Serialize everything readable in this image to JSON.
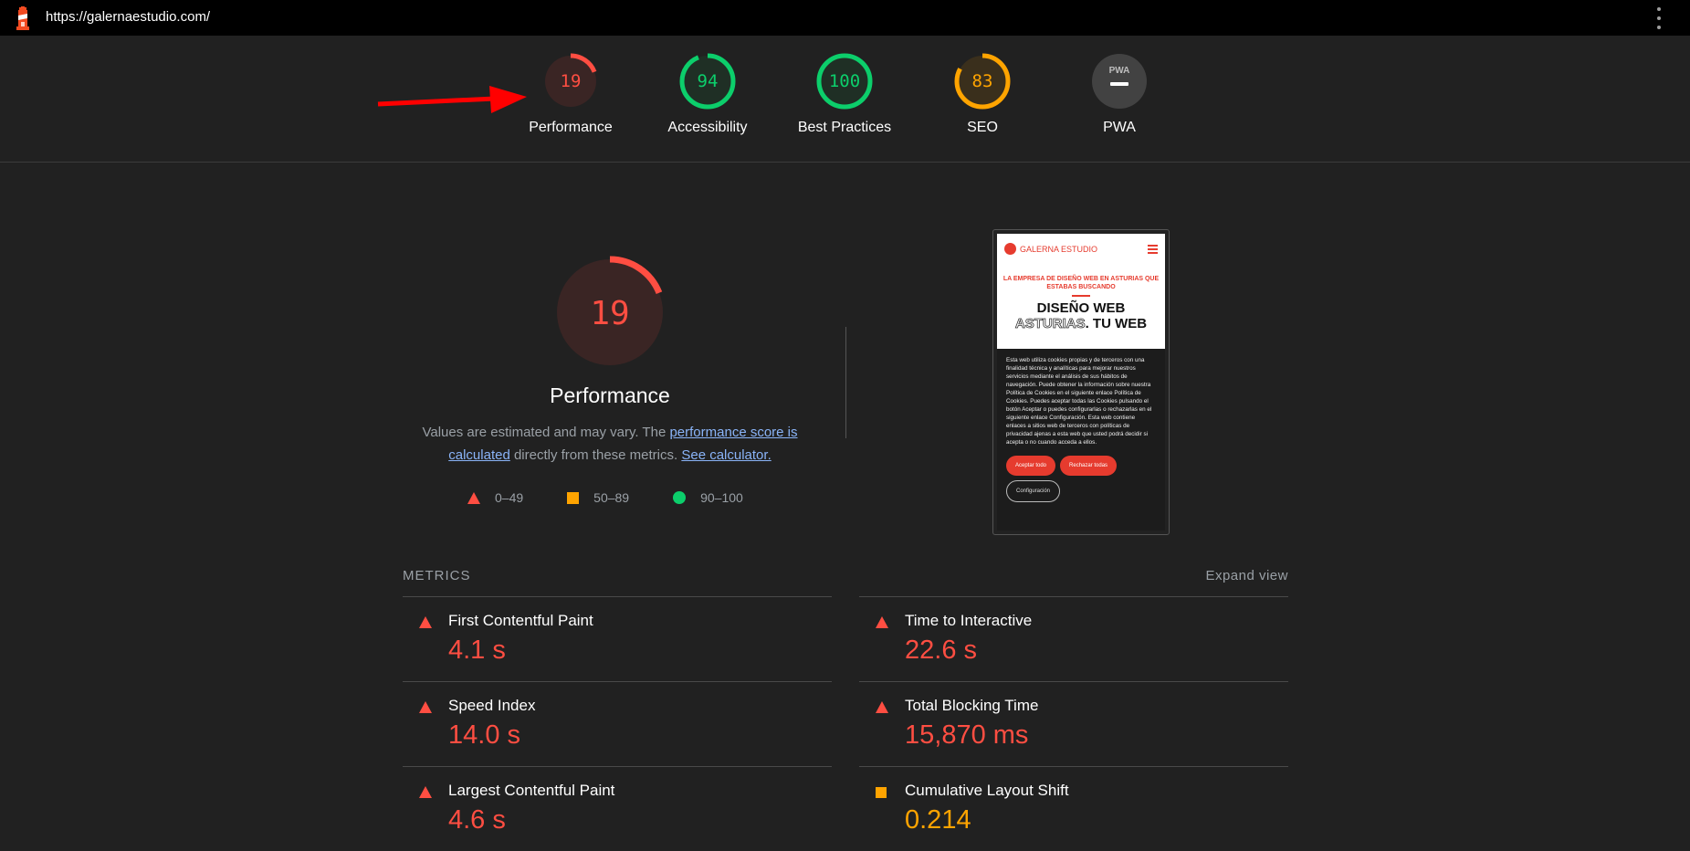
{
  "topbar": {
    "url": "https://galernaestudio.com/",
    "logo_icon": "lighthouse-icon",
    "menu_icon": "kebab-menu-icon"
  },
  "colors": {
    "fail": "#ff4e42",
    "average": "#ffa400",
    "pass": "#0cce6b",
    "link": "#8ab4f8"
  },
  "gauges": [
    {
      "label": "Performance",
      "score": "19",
      "value": 19,
      "status": "fail"
    },
    {
      "label": "Accessibility",
      "score": "94",
      "value": 94,
      "status": "pass"
    },
    {
      "label": "Best Practices",
      "score": "100",
      "value": 100,
      "status": "pass"
    },
    {
      "label": "SEO",
      "score": "83",
      "value": 83,
      "status": "average"
    },
    {
      "label": "PWA",
      "score": "PWA",
      "value": null,
      "status": "neutral"
    }
  ],
  "performance": {
    "score": "19",
    "value": 19,
    "title": "Performance",
    "desc_1": "Values are estimated and may vary. The ",
    "desc_link_1": "performance score is calculated",
    "desc_2": " directly from these metrics. ",
    "desc_link_2": "See calculator."
  },
  "legend": [
    {
      "shape": "triangle",
      "range": "0–49"
    },
    {
      "shape": "square",
      "range": "50–89"
    },
    {
      "shape": "circle",
      "range": "90–100"
    }
  ],
  "screenshot": {
    "brand": "GALERNA ESTUDIO",
    "subtitle": "LA EMPRESA DE DISEÑO WEB EN ASTURIAS QUE ESTABAS BUSCANDO",
    "headline_1": "DISEÑO WEB",
    "headline_2a": "ASTURIAS",
    "headline_2b": ". TU WEB",
    "cookie_text": "Esta web utiliza cookies propias y de terceros con una finalidad técnica y analíticas para mejorar nuestros servicios mediante el análisis de sus hábitos de navegación. Puede obtener la información sobre nuestra Política de Cookies en el siguiente enlace Política de Cookies. Puedes aceptar todas las Cookies pulsando el botón Aceptar o puedes configurarlas o rechazarlas en el siguiente enlace Configuración. Esta web contiene enlaces a sitios web de terceros con políticas de privacidad ajenas a esta web que usted podrá decidir si acepta o no cuando acceda a ellos.",
    "accept": "Aceptar todo",
    "reject": "Rechazar todas",
    "config": "Configuración"
  },
  "metrics": {
    "title": "METRICS",
    "expand": "Expand view",
    "items": [
      {
        "name": "First Contentful Paint",
        "value": "4.1 s",
        "status": "fail"
      },
      {
        "name": "Time to Interactive",
        "value": "22.6 s",
        "status": "fail"
      },
      {
        "name": "Speed Index",
        "value": "14.0 s",
        "status": "fail"
      },
      {
        "name": "Total Blocking Time",
        "value": "15,870 ms",
        "status": "fail"
      },
      {
        "name": "Largest Contentful Paint",
        "value": "4.6 s",
        "status": "fail"
      },
      {
        "name": "Cumulative Layout Shift",
        "value": "0.214",
        "status": "average"
      }
    ]
  }
}
